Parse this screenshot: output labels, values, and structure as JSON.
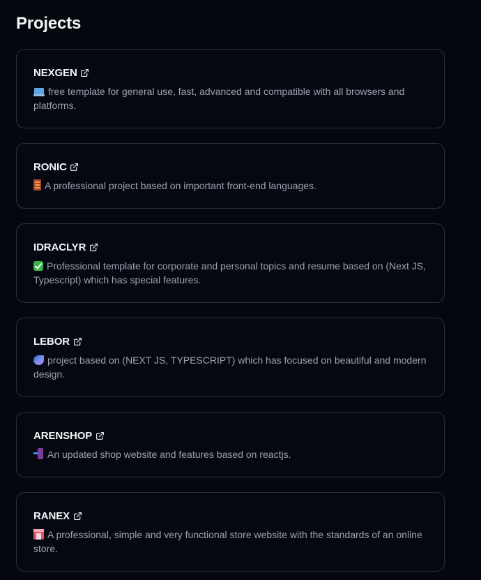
{
  "section": {
    "title": "Projects"
  },
  "projects": [
    {
      "name": "NEXGEN",
      "icon": "laptop-icon",
      "description": "free template for general use, fast, advanced and compatible with all browsers and platforms."
    },
    {
      "name": "RONIC",
      "icon": "abacus-icon",
      "description": "A professional project based on important front-end languages."
    },
    {
      "name": "IDRACLYR",
      "icon": "check-mark-icon",
      "description": "Professional template for corporate and personal topics and resume based on (Next JS, Typescript) which has special features."
    },
    {
      "name": "LEBOR",
      "icon": "comet-icon",
      "description": "project based on (NEXT JS, TYPESCRIPT) which has focused on beautiful and modern design."
    },
    {
      "name": "ARENSHOP",
      "icon": "mobile-arrow-icon",
      "description": "An updated shop website and features based on reactjs."
    },
    {
      "name": "RANEX",
      "icon": "department-store-icon",
      "description": "A professional, simple and very functional store website with the standards of an online store."
    }
  ],
  "colors": {
    "background": "#05070f",
    "card_border": "#2a2f3a",
    "title_text": "#f3f4f6",
    "description_text": "#9ca3af"
  }
}
